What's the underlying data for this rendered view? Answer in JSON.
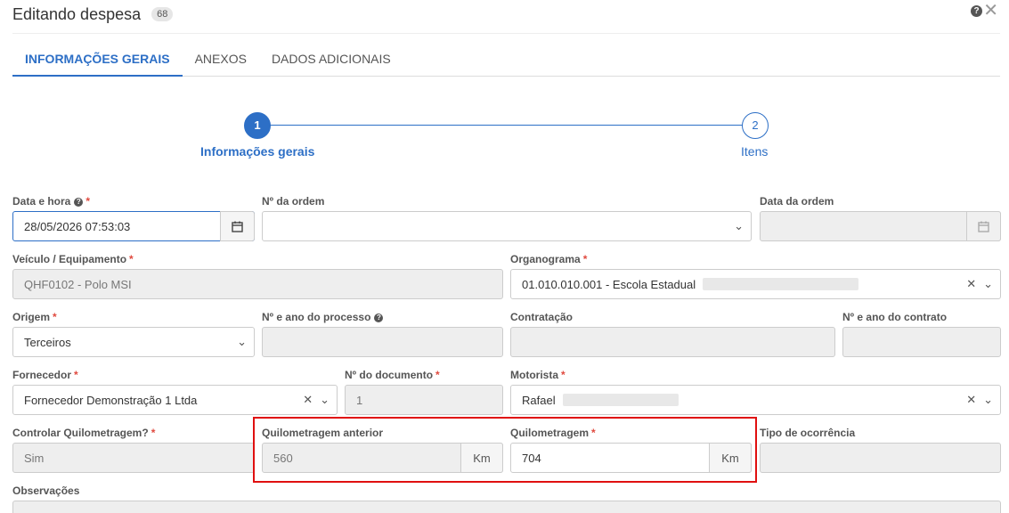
{
  "header": {
    "title": "Editando despesa",
    "badge": "68",
    "help_glyph": "?",
    "close_glyph": "✕"
  },
  "tabs": [
    "INFORMAÇÕES GERAIS",
    "ANEXOS",
    "DADOS ADICIONAIS"
  ],
  "steps": [
    {
      "number": "1",
      "label": "Informações gerais"
    },
    {
      "number": "2",
      "label": "Itens"
    }
  ],
  "form": {
    "data_hora": {
      "label": "Data e hora",
      "value": "28/05/2026 07:53:03"
    },
    "num_ordem": {
      "label": "Nº da ordem",
      "value": ""
    },
    "data_ordem": {
      "label": "Data da ordem",
      "value": ""
    },
    "veiculo": {
      "label": "Veículo / Equipamento",
      "value": "QHF0102 - Polo MSI"
    },
    "organograma": {
      "label": "Organograma",
      "value": "01.010.010.001 - Escola Estadual"
    },
    "origem": {
      "label": "Origem",
      "value": "Terceiros"
    },
    "num_processo": {
      "label": "Nº e ano do processo",
      "value": ""
    },
    "contratacao": {
      "label": "Contratação",
      "value": ""
    },
    "num_contrato": {
      "label": "Nº e ano do contrato",
      "value": ""
    },
    "fornecedor": {
      "label": "Fornecedor",
      "value": "Fornecedor Demonstração 1 Ltda"
    },
    "num_documento": {
      "label": "Nº do documento",
      "value": "1"
    },
    "motorista": {
      "label": "Motorista",
      "value": "Rafael"
    },
    "controlar_km": {
      "label": "Controlar Quilometragem?",
      "value": "Sim"
    },
    "km_anterior": {
      "label": "Quilometragem anterior",
      "value": "560",
      "unit": "Km"
    },
    "km": {
      "label": "Quilometragem",
      "value": "704",
      "unit": "Km"
    },
    "tipo_ocorrencia": {
      "label": "Tipo de ocorrência",
      "value": ""
    },
    "observacoes": {
      "label": "Observações",
      "value": ""
    }
  },
  "glyphs": {
    "required": "*",
    "help": "?",
    "clear": "✕",
    "chevron": "⌄"
  },
  "colors": {
    "accent": "#2d6fc6",
    "required": "#e04a3f",
    "highlight": "#e01010"
  }
}
